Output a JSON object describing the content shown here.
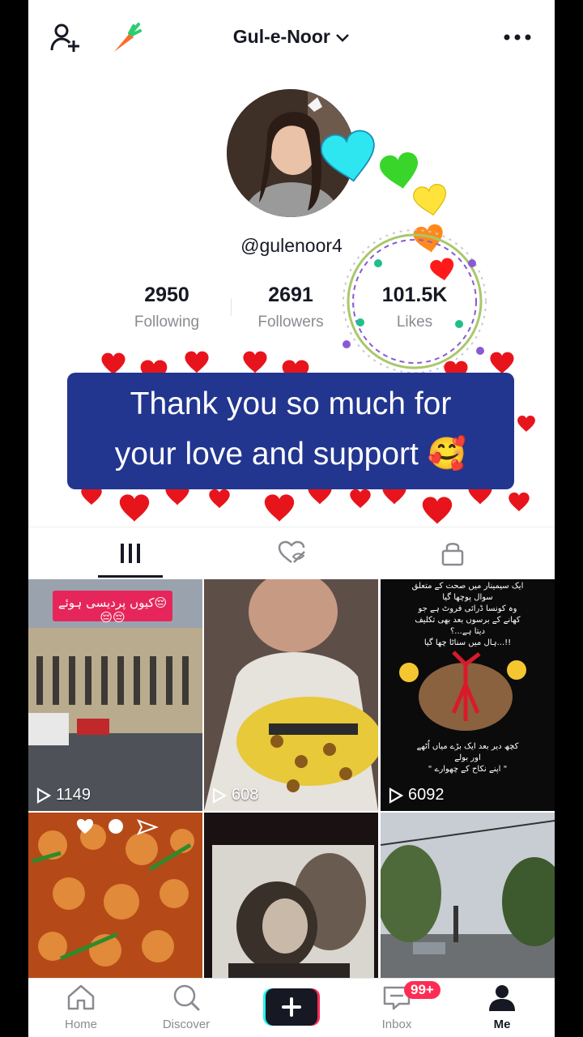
{
  "profile": {
    "name": "Gul-e-Noor",
    "handle": "@gulenoor4",
    "following": {
      "count": "2950",
      "label": "Following"
    },
    "followers": {
      "count": "2691",
      "label": "Followers"
    },
    "likes": {
      "count": "101.5K",
      "label": "Likes"
    }
  },
  "banner": {
    "line1": "Thank you so much for",
    "line2": "your love and support 🥰"
  },
  "videos": [
    {
      "views": "1149",
      "caption": "کیوں پردیسی ہوئے😔😔😔"
    },
    {
      "views": "608"
    },
    {
      "views": "6092",
      "caption_lines": [
        "ایک سیمینار میں صحت کے متعلق",
        "سوال پوچھا گیا",
        "وہ کونسا ڈرائی فروٹ ہے جو",
        "کھانے کے برسوں بعد بھی تکلیف",
        "دیتا ہے...؟",
        "ہال میں سناٹا چھا گیا...!!",
        "کچھ دیر بعد ایک بڑے میاں اُٹھے",
        "اور بولے",
        "\" اپنے نکاح کے چھوارے \""
      ]
    },
    {
      "views": ""
    },
    {
      "views": ""
    },
    {
      "views": ""
    }
  ],
  "nav": {
    "home": "Home",
    "discover": "Discover",
    "inbox": "Inbox",
    "inbox_badge": "99+",
    "me": "Me"
  },
  "colors": {
    "accent": "#fe2c55",
    "banner": "#22358f",
    "text": "#161823",
    "muted": "#8a8b91"
  },
  "icons": [
    "add-user-icon",
    "carrot-icon",
    "chevron-down-icon",
    "more-icon",
    "grid-icon",
    "liked-hidden-icon",
    "lock-icon",
    "play-icon",
    "home-icon",
    "search-icon",
    "plus-icon",
    "inbox-icon",
    "profile-icon"
  ]
}
